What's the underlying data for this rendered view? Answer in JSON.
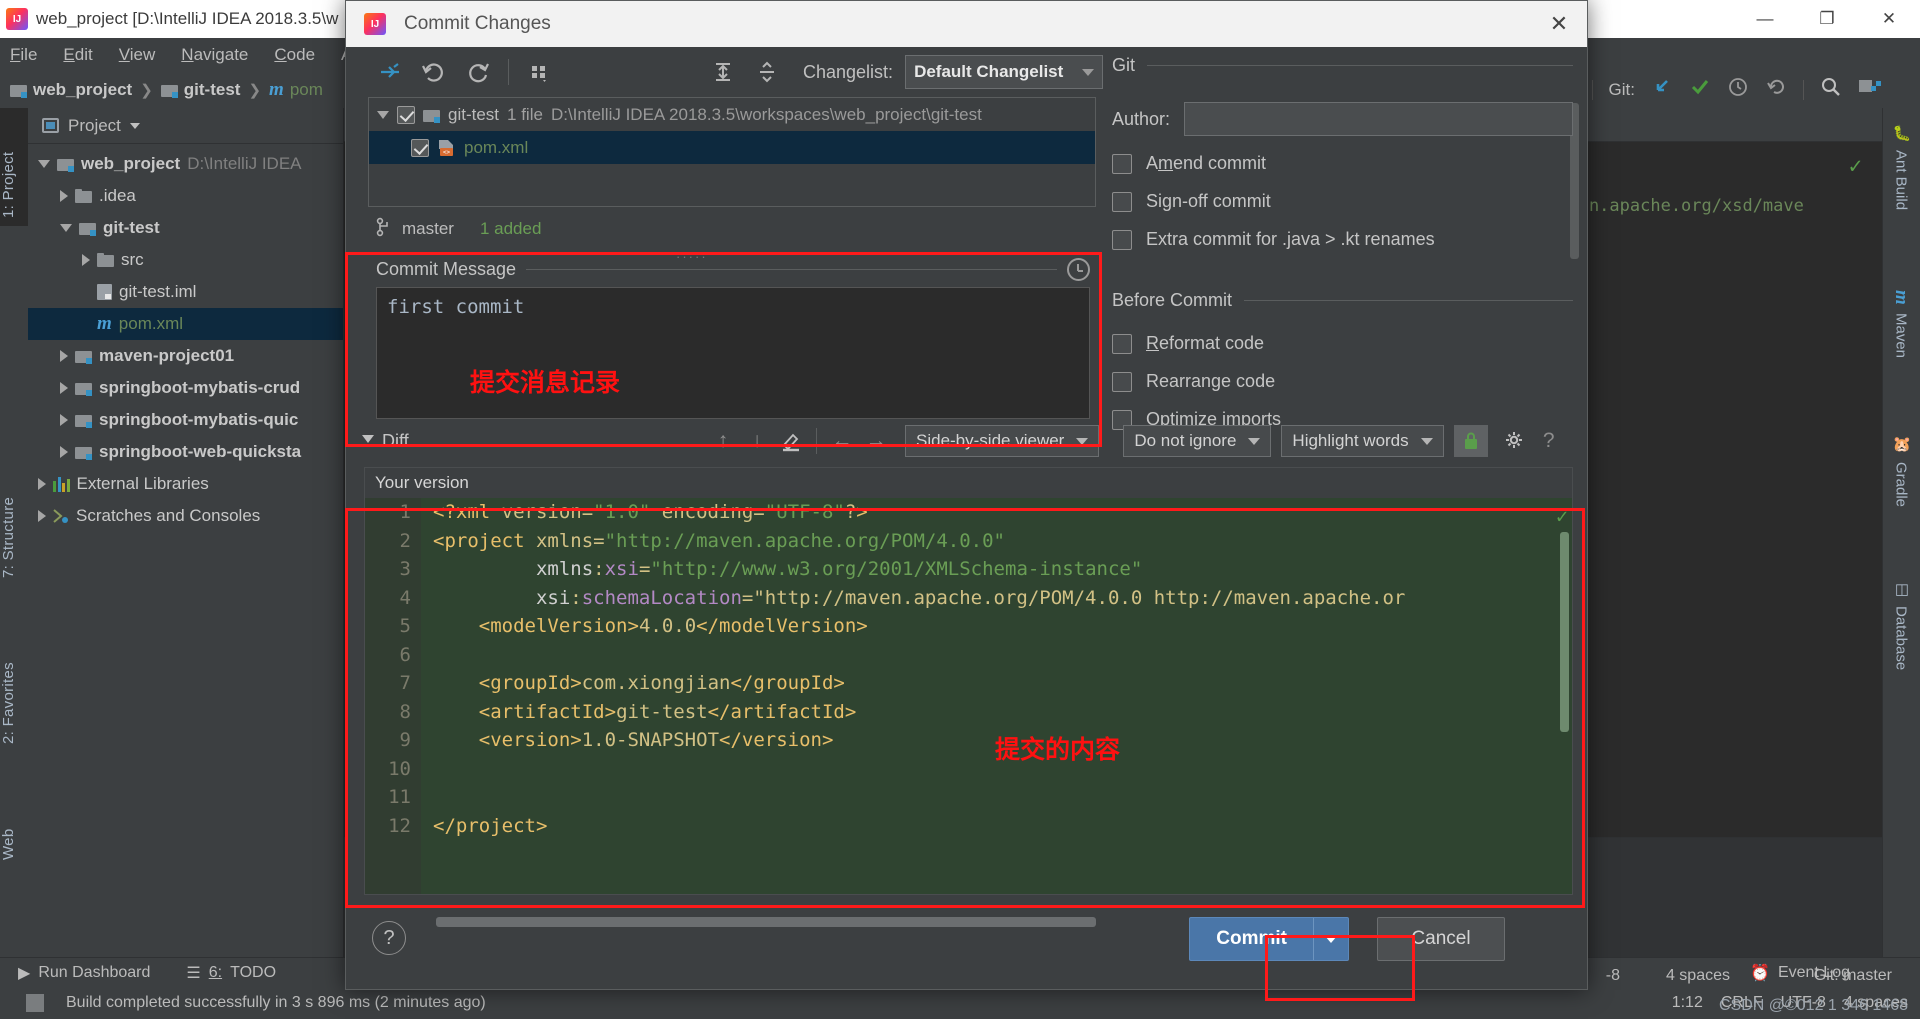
{
  "ide": {
    "title": "web_project [D:\\IntelliJ IDEA 2018.3.5\\w",
    "menu": [
      "File",
      "Edit",
      "View",
      "Navigate",
      "Code",
      "A"
    ],
    "breadcrumb": [
      "web_project",
      "git-test",
      "pom"
    ],
    "window_controls": {
      "minimize": "—",
      "maximize": "❐",
      "close": "✕"
    },
    "git_toolbar_label": "Git:",
    "left_tabs": [
      "1: Project",
      "7: Structure",
      "2: Favorites",
      "Web"
    ],
    "right_tabs": [
      "Ant Build",
      "Maven",
      "Gradle",
      "Database"
    ],
    "editor_line": "maven.apache.org/xsd/mave"
  },
  "project": {
    "header": "Project",
    "tree": [
      {
        "label": "web_project",
        "path": "D:\\IntelliJ IDEA",
        "depth": 0,
        "state": "open",
        "icon": "module-folder",
        "bold": true
      },
      {
        "label": ".idea",
        "path": "",
        "depth": 1,
        "state": "closed",
        "icon": "folder",
        "bold": false
      },
      {
        "label": "git-test",
        "path": "",
        "depth": 1,
        "state": "open",
        "icon": "module-folder",
        "bold": true
      },
      {
        "label": "src",
        "path": "",
        "depth": 2,
        "state": "closed",
        "icon": "folder",
        "bold": false
      },
      {
        "label": "git-test.iml",
        "path": "",
        "depth": 2,
        "state": "leaf",
        "icon": "iml",
        "bold": false
      },
      {
        "label": "pom.xml",
        "path": "",
        "depth": 2,
        "state": "leaf",
        "icon": "maven-m",
        "bold": false,
        "selected": true
      },
      {
        "label": "maven-project01",
        "path": "",
        "depth": 1,
        "state": "closed",
        "icon": "module-folder",
        "bold": true
      },
      {
        "label": "springboot-mybatis-crud",
        "path": "",
        "depth": 1,
        "state": "closed",
        "icon": "module-folder",
        "bold": true
      },
      {
        "label": "springboot-mybatis-quic",
        "path": "",
        "depth": 1,
        "state": "closed",
        "icon": "module-folder",
        "bold": true
      },
      {
        "label": "springboot-web-quicksta",
        "path": "",
        "depth": 1,
        "state": "closed",
        "icon": "module-folder",
        "bold": true
      },
      {
        "label": "External Libraries",
        "path": "",
        "depth": 0,
        "state": "closed",
        "icon": "libraries",
        "bold": false
      },
      {
        "label": "Scratches and Consoles",
        "path": "",
        "depth": 0,
        "state": "closed",
        "icon": "scratches",
        "bold": false
      }
    ]
  },
  "dialog": {
    "title": "Commit Changes",
    "toolbar_icons": [
      "collapse-to-left-icon",
      "revert-icon",
      "refresh-icon",
      "group-by-icon",
      "expand-all-icon",
      "collapse-all-icon"
    ],
    "changelist_label": "Changelist:",
    "changelist_value": "Default Changelist",
    "files": {
      "group": {
        "name": "git-test",
        "count": "1 file",
        "path": "D:\\IntelliJ IDEA 2018.3.5\\workspaces\\web_project\\git-test"
      },
      "items": [
        {
          "name": "pom.xml"
        }
      ]
    },
    "branch": "master",
    "added_status": "1 added",
    "commit_message": {
      "legend": "Commit Message",
      "value": "first commit"
    },
    "git_group": {
      "title": "Git",
      "author_label": "Author:",
      "author_value": "",
      "checkboxes": [
        {
          "label": "Amend commit",
          "mnemonic": "m",
          "checked": false
        },
        {
          "label": "Sign-off commit",
          "mnemonic": "g",
          "checked": false
        },
        {
          "label": "Extra commit for .java > .kt renames",
          "mnemonic": "",
          "checked": false
        }
      ]
    },
    "before_commit": {
      "title": "Before Commit",
      "checkboxes": [
        {
          "label": "Reformat code",
          "mnemonic": "R",
          "checked": false
        },
        {
          "label": "Rearrange code",
          "mnemonic": "",
          "checked": false
        },
        {
          "label": "Optimize imports",
          "mnemonic": "O",
          "checked": false
        }
      ]
    },
    "diff": {
      "section_label": "Diff",
      "viewer_mode": "Side-by-side viewer",
      "ignore_mode": "Do not ignore",
      "highlight_mode": "Highlight words",
      "lock_icon": "lock-icon",
      "settings_icon": "gear-icon",
      "help_icon": "question-mark-icon",
      "pane_label": "Your version",
      "lines": [
        {
          "n": "1",
          "text": "<?xml version=\"1.0\" encoding=\"UTF-8\"?>"
        },
        {
          "n": "2",
          "text": "<project xmlns=\"http://maven.apache.org/POM/4.0.0\""
        },
        {
          "n": "3",
          "text": "         xmlns:xsi=\"http://www.w3.org/2001/XMLSchema-instance\""
        },
        {
          "n": "4",
          "text": "         xsi:schemaLocation=\"http://maven.apache.org/POM/4.0.0 http://maven.apache.or"
        },
        {
          "n": "5",
          "text": "    <modelVersion>4.0.0</modelVersion>"
        },
        {
          "n": "6",
          "text": ""
        },
        {
          "n": "7",
          "text": "    <groupId>com.xiongjian</groupId>"
        },
        {
          "n": "8",
          "text": "    <artifactId>git-test</artifactId>"
        },
        {
          "n": "9",
          "text": "    <version>1.0-SNAPSHOT</version>"
        },
        {
          "n": "10",
          "text": ""
        },
        {
          "n": "11",
          "text": ""
        },
        {
          "n": "12",
          "text": "</project>"
        }
      ]
    },
    "footer": {
      "help": "?",
      "commit": "Commit",
      "cancel": "Cancel"
    }
  },
  "annotations": [
    {
      "text": "提交消息记录",
      "color": "#ff1111"
    },
    {
      "text": "提交的内容",
      "color": "#ff1111"
    }
  ],
  "bottombar": {
    "run_dashboard": "Run Dashboard",
    "todo_num": "6:",
    "todo_label": "TODO",
    "event_log": "Event Log"
  },
  "statusbar": {
    "build_message": "Build completed successfully in 3 s 896 ms (2 minutes ago)",
    "position": "1:12",
    "line_sep": "CRLF",
    "encoding": "UTF-8",
    "indent": "4 spaces",
    "indent_alt": "4 spaces",
    "branch": "Git: master",
    "partial_right": "-8"
  },
  "watermark": "CSDN @©012 1 346 1468",
  "colors": {
    "accent_blue": "#4a76a8",
    "annotation_red": "#ff1111",
    "selection": "#0d293e",
    "diff_green_bg": "#2f4430",
    "added_green": "#6a9e55"
  }
}
